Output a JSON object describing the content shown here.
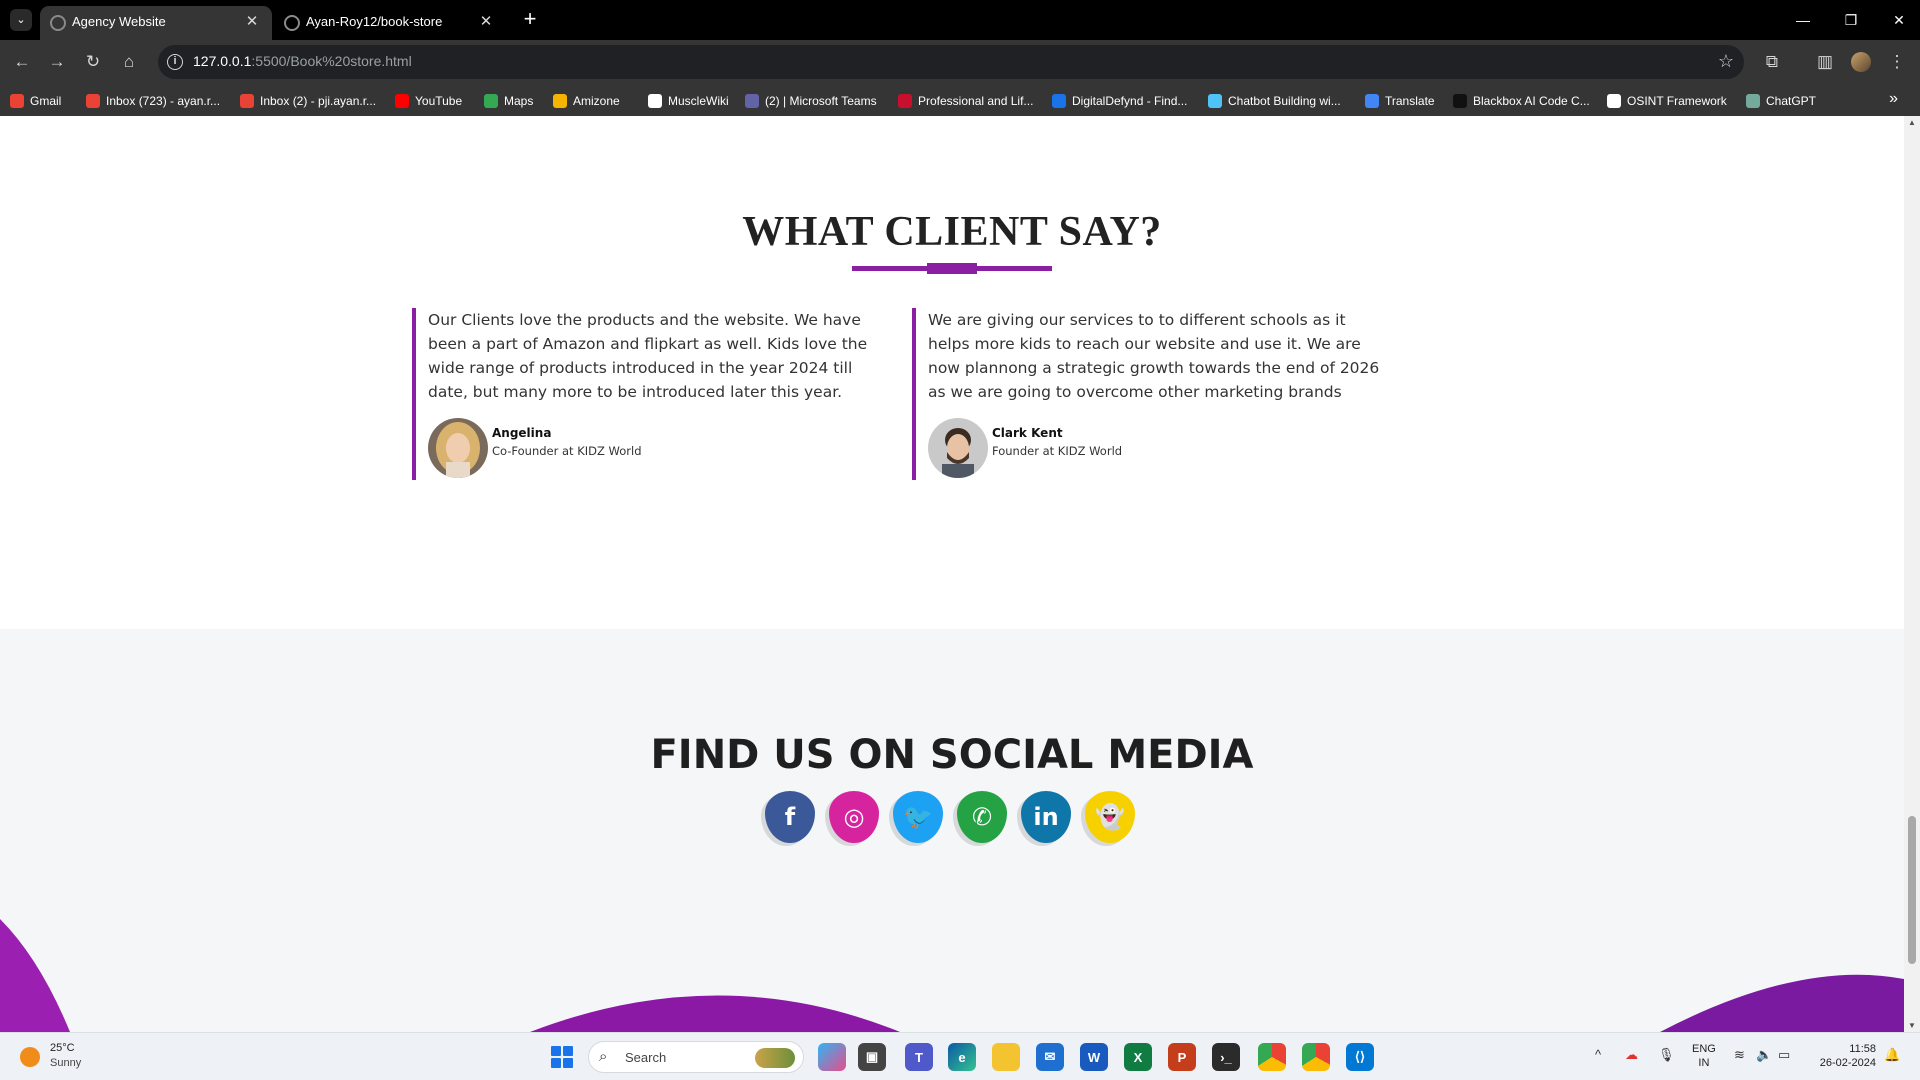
{
  "browser": {
    "tabs": [
      {
        "title": "Agency Website",
        "active": true
      },
      {
        "title": "Ayan-Roy12/book-store",
        "active": false
      }
    ],
    "url_host": "127.0.0.1",
    "url_rest": ":5500/Book%20store.html",
    "bookmarks": [
      {
        "label": "Gmail",
        "icon_color": "#ea4335"
      },
      {
        "label": "Inbox (723) - ayan.r...",
        "icon_color": "#ea4335"
      },
      {
        "label": "Inbox (2) - pji.ayan.r...",
        "icon_color": "#ea4335"
      },
      {
        "label": "YouTube",
        "icon_color": "#ff0000"
      },
      {
        "label": "Maps",
        "icon_color": "#34a853"
      },
      {
        "label": "Amizone",
        "icon_color": "#f4b400"
      },
      {
        "label": "MuscleWiki",
        "icon_color": "#ffffff"
      },
      {
        "label": "(2) | Microsoft Teams",
        "icon_color": "#6264a7"
      },
      {
        "label": "Professional and Lif...",
        "icon_color": "#c8102e"
      },
      {
        "label": "DigitalDefynd - Find...",
        "icon_color": "#1a73e8"
      },
      {
        "label": "Chatbot Building wi...",
        "icon_color": "#4fc3f7"
      },
      {
        "label": "Translate",
        "icon_color": "#4285f4"
      },
      {
        "label": "Blackbox AI Code C...",
        "icon_color": "#111111"
      },
      {
        "label": "OSINT Framework",
        "icon_color": "#ffffff"
      },
      {
        "label": "ChatGPT",
        "icon_color": "#74aa9c"
      }
    ]
  },
  "testimonials": {
    "title": "WHAT CLIENT SAY?",
    "accent": "#8a1fa3",
    "cards": [
      {
        "quote": "Our Clients love the products and the website. We have been a part of Amazon and flipkart as well. Kids love the wide range of products introduced in the year 2024 till date, but many more to be introduced later this year.",
        "name": "Angelina",
        "role": "Co-Founder at KIDZ World"
      },
      {
        "quote": "We are giving our services to to different schools as it helps more kids to reach our website and use it. We are now plannong a strategic growth towards the end of 2026 as we are going to overcome other marketing brands",
        "name": "Clark Kent",
        "role": "Founder at KIDZ World"
      }
    ]
  },
  "social": {
    "title": "FIND US ON SOCIAL MEDIA",
    "icons": [
      {
        "name": "facebook-icon",
        "glyph": "f",
        "color": "#3b5998"
      },
      {
        "name": "instagram-icon",
        "glyph": "◎",
        "color": "#d6249f"
      },
      {
        "name": "twitter-icon",
        "glyph": "🐦",
        "color": "#1da1f2"
      },
      {
        "name": "whatsapp-icon",
        "glyph": "✆",
        "color": "#25a244"
      },
      {
        "name": "linkedin-icon",
        "glyph": "in",
        "color": "#0e76a8"
      },
      {
        "name": "snapchat-icon",
        "glyph": "👻",
        "color": "#f7d000"
      }
    ]
  },
  "taskbar": {
    "temp": "25°C",
    "condition": "Sunny",
    "search_placeholder": "Search",
    "lang_top": "ENG",
    "lang_bottom": "IN",
    "time": "11:58",
    "date": "26-02-2024"
  }
}
